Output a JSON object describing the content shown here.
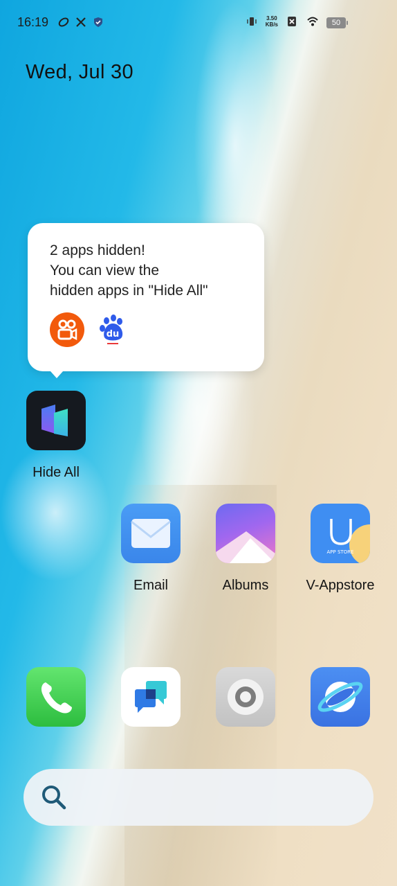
{
  "status_bar": {
    "time": "16:19",
    "net_speed_value": "3.50",
    "net_speed_unit": "KB/s",
    "battery": "50",
    "left_icons": [
      "sync-icon",
      "tools-icon",
      "shield-icon"
    ],
    "right_icons": [
      "vibrate-icon",
      "no-sim-icon",
      "wifi-icon",
      "battery-icon"
    ]
  },
  "date": "Wed, Jul 30",
  "tooltip": {
    "line1": "2 apps hidden!",
    "line2": "You can view the",
    "line3": "hidden apps in \"Hide All\"",
    "hidden_apps": [
      "kuaishou-icon",
      "baidu-icon"
    ]
  },
  "apps": {
    "hide_all": "Hide All",
    "email": "Email",
    "albums": "Albums",
    "appstore": "V-Appstore",
    "appstore_icon_text": "APP STORE"
  },
  "dock": [
    "phone-icon",
    "messages-icon",
    "settings-icon",
    "browser-icon"
  ],
  "colors": {
    "tooltip_bg": "#ffffff",
    "search_bar_bg": "#eef2f7",
    "search_icon": "#1f5a78"
  }
}
